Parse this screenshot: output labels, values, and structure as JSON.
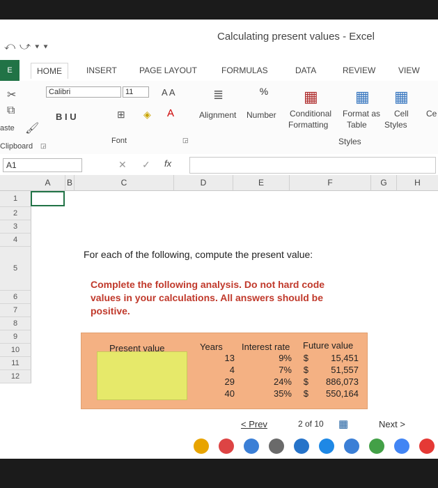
{
  "window": {
    "title": "Calculating present values - Excel"
  },
  "tabs": [
    "HOME",
    "INSERT",
    "PAGE LAYOUT",
    "FORMULAS",
    "DATA",
    "REVIEW",
    "VIEW"
  ],
  "ribbon": {
    "paste": "aste",
    "clipboard": "Clipboard",
    "font_name": "Calibri",
    "font_size": "11",
    "grow_shrink": "A A",
    "biu": "B  I  U",
    "font_group": "Font",
    "alignment": "Alignment",
    "number": "Number",
    "conditional_formatting_1": "Conditional",
    "conditional_formatting_2": "Formatting",
    "format_as_table_1": "Format as",
    "format_as_table_2": "Table",
    "cell_styles_1": "Cell",
    "cell_styles_2": "Styles",
    "styles_group": "Styles",
    "cells_partial": "Ce",
    "percent": "%"
  },
  "formula_bar": {
    "name_box": "A1",
    "fx": "fx"
  },
  "columns": [
    "A",
    "B",
    "C",
    "D",
    "E",
    "F",
    "G",
    "H"
  ],
  "rows": [
    "1",
    "2",
    "3",
    "4",
    "5",
    "6",
    "7",
    "8",
    "9",
    "10",
    "11",
    "12"
  ],
  "sheet": {
    "prompt": "For each of the following, compute the present value:",
    "instruction": "Complete the following analysis. Do not hard code values in your calculations. All answers should be positive.",
    "headers": {
      "present_value": "Present value",
      "years": "Years",
      "interest_rate": "Interest rate",
      "future_value": "Future value"
    },
    "rows": [
      {
        "years": "13",
        "rate": "9%",
        "currency": "$",
        "fv": "15,451"
      },
      {
        "years": "4",
        "rate": "7%",
        "currency": "$",
        "fv": "51,557"
      },
      {
        "years": "29",
        "rate": "24%",
        "currency": "$",
        "fv": "886,073"
      },
      {
        "years": "40",
        "rate": "35%",
        "currency": "$",
        "fv": "550,164"
      }
    ]
  },
  "pager": {
    "prev": "< Prev",
    "position": "2 of 10",
    "next": "Next >"
  }
}
